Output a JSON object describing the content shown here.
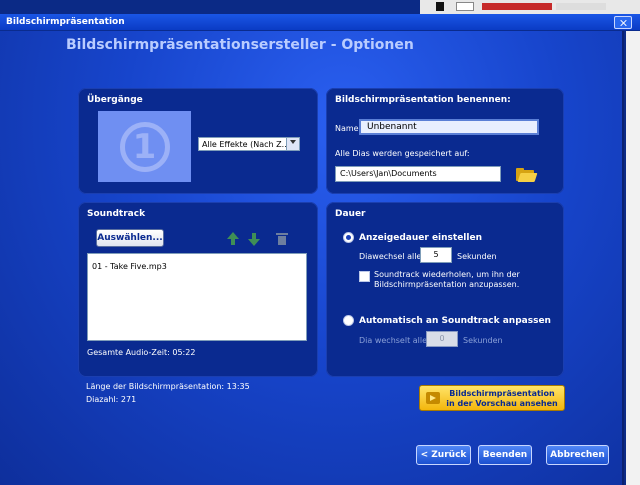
{
  "window": {
    "title": "Bildschirmpräsentation"
  },
  "heading": "Bildschirmpräsentationsersteller - Optionen",
  "transitions": {
    "title": "Übergänge",
    "preview_number": "1",
    "effect_select": "Alle Effekte (Nach Z..."
  },
  "naming": {
    "title": "Bildschirmpräsentation benennen:",
    "name_label": "Name",
    "name_value": "Unbenannt",
    "save_label": "Alle Dias werden gespeichert auf:",
    "save_path": "C:\\Users\\Jan\\Documents"
  },
  "soundtrack": {
    "title": "Soundtrack",
    "select_button": "Auswählen...",
    "tracks": [
      "01 - Take Five.mp3"
    ],
    "total_label": "Gesamte Audio-Zeit: 05:22"
  },
  "duration": {
    "title": "Dauer",
    "option_manual": "Anzeigedauer einstellen",
    "interval_label": "Diawechsel alle",
    "interval_value": "5",
    "interval_unit": "Sekunden",
    "repeat_label": "Soundtrack wiederholen, um ihn der Bildschirmpräsentation anzupassen.",
    "option_auto": "Automatisch an Soundtrack anpassen",
    "auto_label": "Dia wechselt alle",
    "auto_value": "0",
    "auto_unit": "Sekunden"
  },
  "summary": {
    "length": "Länge der Bildschirmpräsentation: 13:35",
    "count": "Diazahl: 271"
  },
  "preview_button": "Bildschirmpräsentation in der Vorschau ansehen",
  "footer": {
    "back": "< Zurück",
    "finish": "Beenden",
    "cancel": "Abbrechen"
  }
}
